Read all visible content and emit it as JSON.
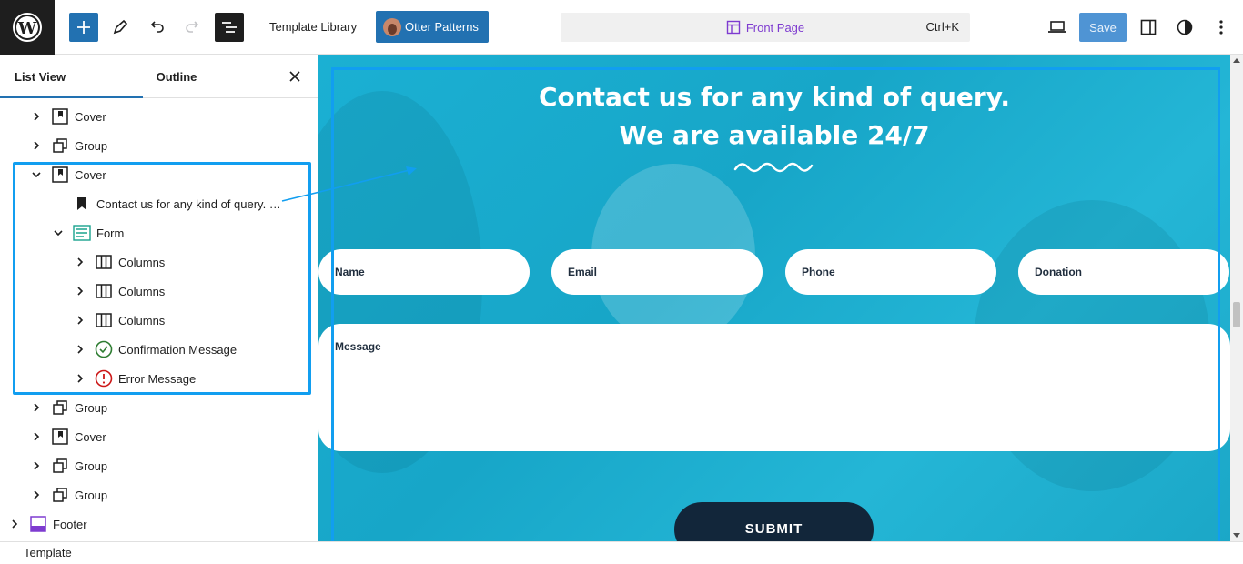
{
  "topbar": {
    "template_library": "Template Library",
    "otter_patterns": "Otter Patterns",
    "command": {
      "title": "Front Page",
      "shortcut": "Ctrl+K"
    },
    "save": "Save"
  },
  "sidebar": {
    "tabs": [
      "List View",
      "Outline"
    ],
    "items": [
      {
        "label": "Cover",
        "icon": "cover-icon"
      },
      {
        "label": "Group",
        "icon": "group-icon"
      },
      {
        "label": "Cover",
        "icon": "cover-icon"
      },
      {
        "label": "Contact us for any kind of query. …",
        "icon": "heading-bookmark-icon"
      },
      {
        "label": "Form",
        "icon": "form-icon"
      },
      {
        "label": "Columns",
        "icon": "columns-icon"
      },
      {
        "label": "Columns",
        "icon": "columns-icon"
      },
      {
        "label": "Columns",
        "icon": "columns-icon"
      },
      {
        "label": "Confirmation Message",
        "icon": "check-circle-icon"
      },
      {
        "label": "Error Message",
        "icon": "error-circle-icon"
      },
      {
        "label": "Group",
        "icon": "group-icon"
      },
      {
        "label": "Cover",
        "icon": "cover-icon"
      },
      {
        "label": "Group",
        "icon": "group-icon"
      },
      {
        "label": "Group",
        "icon": "group-icon"
      },
      {
        "label": "Footer",
        "icon": "footer-icon"
      }
    ]
  },
  "canvas": {
    "title_line1": "Contact us for any kind of query.",
    "title_line2": "We are available 24/7",
    "fields": [
      "Name",
      "Email",
      "Phone",
      "Donation"
    ],
    "message": "Message",
    "submit": "SUBMIT"
  },
  "footer": {
    "breadcrumb": "Template"
  },
  "colors": {
    "accent": "#2271b1",
    "selection": "#119ef0",
    "canvas_bg": "#1bb0d3",
    "submit_bg": "#12263a"
  }
}
